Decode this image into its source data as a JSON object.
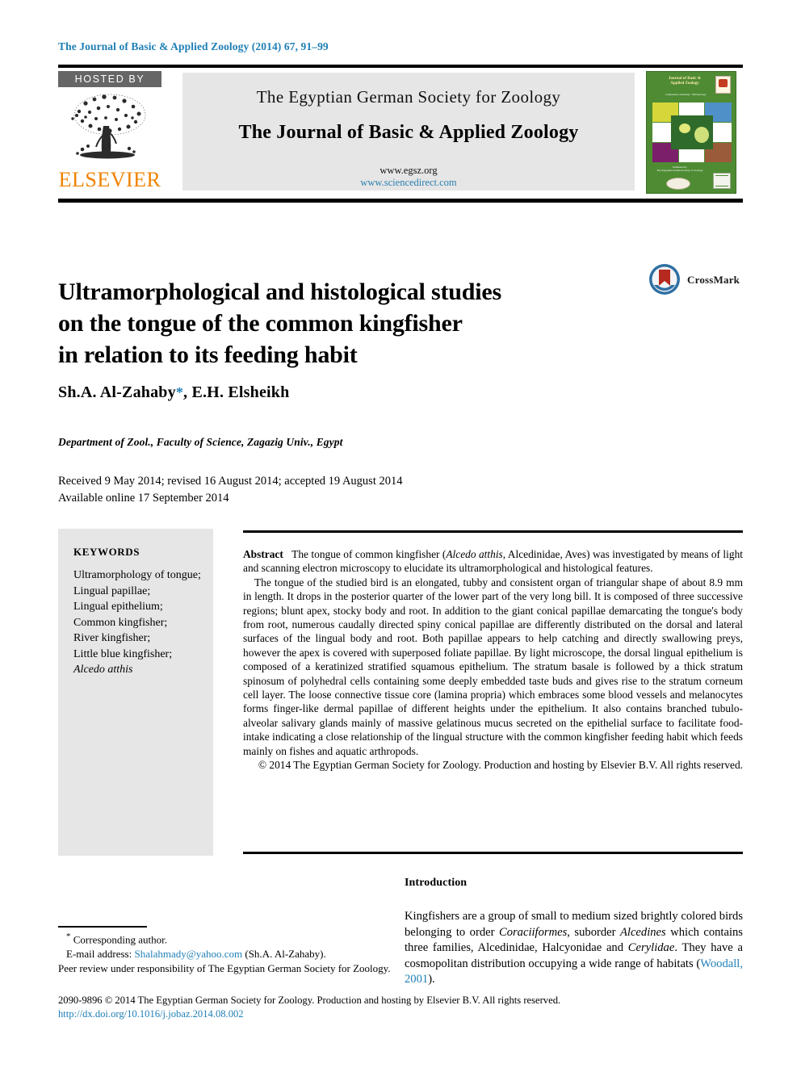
{
  "running_head": "The Journal of Basic & Applied Zoology (2014) 67, 91–99",
  "banner": {
    "hosted_by": "HOSTED BY",
    "publisher": "ELSEVIER",
    "society": "The Egyptian German Society for Zoology",
    "journal": "The Journal of Basic & Applied Zoology",
    "url_society": "www.egsz.org",
    "url_sciencedirect": "www.sciencedirect.com",
    "cover": {
      "title": "Journal of Basic &\nApplied Zoology",
      "subtitle": "Comparative Anatomy · Embryology",
      "footer": "Published by\nThe Egyptian German Society of Zoology"
    }
  },
  "article": {
    "title_line_1": "Ultramorphological and histological studies",
    "title_line_2": "on the tongue of the common kingfisher",
    "title_line_3": "in relation to its feeding habit",
    "crossmark_label": "CrossMark",
    "authors": "Sh.A. Al-Zahaby",
    "authors_star": "*",
    "authors_rest": ", E.H. Elsheikh",
    "affiliation": "Department of Zool., Faculty of Science, Zagazig Univ., Egypt",
    "dates_line_1": "Received 9 May 2014; revised 16 August 2014; accepted 19 August 2014",
    "dates_line_2": "Available online 17 September 2014"
  },
  "keywords": {
    "heading": "KEYWORDS",
    "items": [
      "Ultramorphology of tongue;",
      "Lingual papillae;",
      "Lingual epithelium;",
      "Common kingfisher;",
      "River kingfisher;",
      "Little blue kingfisher;"
    ],
    "italic_item": "Alcedo atthis"
  },
  "abstract": {
    "label": "Abstract",
    "p1_a": "The tongue of common kingfisher (",
    "p1_species": "Alcedo atthis",
    "p1_b": ", Alcedinidae, Aves) was investigated by means of light and scanning electron microscopy to elucidate its ultramorphological and histological features.",
    "p2": "The tongue of the studied bird is an elongated, tubby and consistent organ of triangular shape of about 8.9 mm in length. It drops in the posterior quarter of the lower part of the very long bill. It is composed of three successive regions; blunt apex, stocky body and root. In addition to the giant conical papillae demarcating the tongue's body from root, numerous caudally directed spiny conical papillae are differently distributed on the dorsal and lateral surfaces of the lingual body and root. Both papillae appears to help catching and directly swallowing preys, however the apex is covered with superposed foliate papillae. By light microscope, the dorsal lingual epithelium is composed of a keratinized stratified squamous epithelium. The stratum basale is followed by a thick stratum spinosum of polyhedral cells containing some deeply embedded taste buds and gives rise to the stratum corneum cell layer. The loose connective tissue core (lamina propria) which embraces some blood vessels and melanocytes forms finger-like dermal papillae of different heights under the epithelium. It also contains branched tubulo-alveolar salivary glands mainly of massive gelatinous mucus secreted on the epithelial surface to facilitate food-intake indicating a close relationship of the lingual structure with the common kingfisher feeding habit which feeds mainly on fishes and aquatic arthropods.",
    "copyright": "© 2014 The Egyptian German Society for Zoology. Production and hosting by Elsevier B.V. All rights reserved."
  },
  "introduction": {
    "heading": "Introduction",
    "t1": "Kingfishers are a group of small to medium sized brightly colored birds belonging to order ",
    "i1": "Coraciiformes",
    "t2": ", suborder ",
    "i2": "Alcedines",
    "t3": " which contains three families, Alcedinidae, Halcyonidae and ",
    "i3": "Cerylidae",
    "t4": ". They have a cosmopolitan distribution occupying a wide range of habitats (",
    "ref": "Woodall, 2001",
    "t5": ")."
  },
  "footnotes": {
    "corresponding": "Corresponding author.",
    "email_label": "E-mail address:",
    "email": "Shalahmady@yahoo.com",
    "email_owner": "(Sh.A. Al-Zahaby).",
    "peer_review": "Peer review under responsibility of The Egyptian German Society for Zoology."
  },
  "colophon": {
    "issn_line": "2090-9896 © 2014 The Egyptian German Society for Zoology. Production and hosting by Elsevier B.V. All rights reserved.",
    "doi": "http://dx.doi.org/10.1016/j.jobaz.2014.08.002"
  },
  "colors": {
    "link": "#1f7fb5",
    "elsevier_orange": "#ef8200",
    "banner_gray": "#e6e6e6",
    "hosted_gray": "#666666",
    "cover_green": "#4e8b33"
  }
}
